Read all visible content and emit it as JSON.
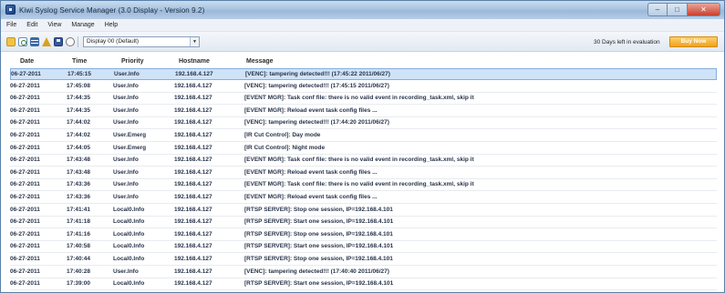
{
  "window": {
    "title": "Kiwi Syslog Service Manager (3.0 Display - Version 9.2)",
    "controls": {
      "minimize": "–",
      "maximize": "□",
      "close": "✕"
    }
  },
  "menu": {
    "items": [
      "File",
      "Edit",
      "View",
      "Manage",
      "Help"
    ]
  },
  "toolbar": {
    "icons": [
      "open-icon",
      "refresh-icon",
      "grid-icon",
      "alert-icon",
      "save-icon",
      "power-icon"
    ],
    "filter_value": "Display 00 (Default)",
    "evaluation_text": "30 Days left in evaluation",
    "buy_label": "Buy Now"
  },
  "table": {
    "headers": {
      "date": "Date",
      "time": "Time",
      "priority": "Priority",
      "hostname": "Hostname",
      "message": "Message"
    },
    "selected_row": 0,
    "rows": [
      {
        "date": "06-27-2011",
        "time": "17:45:15",
        "priority": "User.Info",
        "hostname": "192.168.4.127",
        "message": "[VENC]: tampering detected!!! (17:45:22 2011/06/27)"
      },
      {
        "date": "06-27-2011",
        "time": "17:45:08",
        "priority": "User.Info",
        "hostname": "192.168.4.127",
        "message": "[VENC]: tampering detected!!! (17:45:15 2011/06/27)"
      },
      {
        "date": "06-27-2011",
        "time": "17:44:35",
        "priority": "User.Info",
        "hostname": "192.168.4.127",
        "message": "[EVENT MGR]: Task conf file: there is no valid event in recording_task.xml, skip it"
      },
      {
        "date": "06-27-2011",
        "time": "17:44:35",
        "priority": "User.Info",
        "hostname": "192.168.4.127",
        "message": "[EVENT MGR]: Reload event task config files ..."
      },
      {
        "date": "06-27-2011",
        "time": "17:44:02",
        "priority": "User.Info",
        "hostname": "192.168.4.127",
        "message": "[VENC]: tampering detected!!! (17:44:20 2011/06/27)"
      },
      {
        "date": "06-27-2011",
        "time": "17:44:02",
        "priority": "User.Emerg",
        "hostname": "192.168.4.127",
        "message": "[IR Cut Control]: Day mode"
      },
      {
        "date": "06-27-2011",
        "time": "17:44:05",
        "priority": "User.Emerg",
        "hostname": "192.168.4.127",
        "message": "[IR Cut Control]: Night mode"
      },
      {
        "date": "06-27-2011",
        "time": "17:43:48",
        "priority": "User.Info",
        "hostname": "192.168.4.127",
        "message": "[EVENT MGR]: Task conf file: there is no valid event in recording_task.xml, skip it"
      },
      {
        "date": "06-27-2011",
        "time": "17:43:48",
        "priority": "User.Info",
        "hostname": "192.168.4.127",
        "message": "[EVENT MGR]: Reload event task config files ..."
      },
      {
        "date": "06-27-2011",
        "time": "17:43:36",
        "priority": "User.Info",
        "hostname": "192.168.4.127",
        "message": "[EVENT MGR]: Task conf file: there is no valid event in recording_task.xml, skip it"
      },
      {
        "date": "06-27-2011",
        "time": "17:43:36",
        "priority": "User.Info",
        "hostname": "192.168.4.127",
        "message": "[EVENT MGR]: Reload event task config files ..."
      },
      {
        "date": "06-27-2011",
        "time": "17:41:41",
        "priority": "Local0.Info",
        "hostname": "192.168.4.127",
        "message": "[RTSP SERVER]: Stop one session, IP=192.168.4.101"
      },
      {
        "date": "06-27-2011",
        "time": "17:41:18",
        "priority": "Local0.Info",
        "hostname": "192.168.4.127",
        "message": "[RTSP SERVER]: Start one session, IP=192.168.4.101"
      },
      {
        "date": "06-27-2011",
        "time": "17:41:16",
        "priority": "Local0.Info",
        "hostname": "192.168.4.127",
        "message": "[RTSP SERVER]: Stop one session, IP=192.168.4.101"
      },
      {
        "date": "06-27-2011",
        "time": "17:40:58",
        "priority": "Local0.Info",
        "hostname": "192.168.4.127",
        "message": "[RTSP SERVER]: Start one session, IP=192.168.4.101"
      },
      {
        "date": "06-27-2011",
        "time": "17:40:44",
        "priority": "Local0.Info",
        "hostname": "192.168.4.127",
        "message": "[RTSP SERVER]: Stop one session, IP=192.168.4.101"
      },
      {
        "date": "06-27-2011",
        "time": "17:40:28",
        "priority": "User.Info",
        "hostname": "192.168.4.127",
        "message": "[VENC]: tampering detected!!! (17:40:40 2011/06/27)"
      },
      {
        "date": "06-27-2011",
        "time": "17:39:00",
        "priority": "Local0.Info",
        "hostname": "192.168.4.127",
        "message": "[RTSP SERVER]: Start one session, IP=192.168.4.101"
      }
    ]
  }
}
